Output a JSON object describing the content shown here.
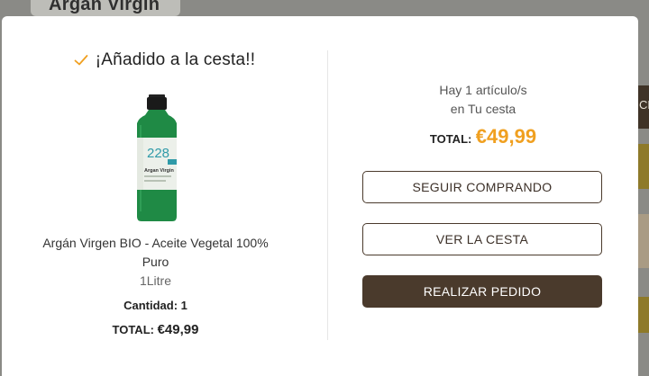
{
  "background": {
    "top_product_label": "Argán Virgin",
    "right_partial_text": "CE"
  },
  "modal": {
    "header": {
      "icon": "check-icon",
      "title": "¡Añadido a la cesta!!"
    },
    "product": {
      "image": "argan-oil-bottle",
      "image_label_number": "228",
      "image_label_name": "Argan Virgin",
      "name": "Argán Virgen BIO - Aceite Vegetal 100% Puro",
      "size": "1Litre",
      "quantity_label": "Cantidad:",
      "quantity_value": "1",
      "total_label": "TOTAL:",
      "total_value": "€49,99"
    },
    "cart": {
      "info_line1": "Hay 1 artículo/s",
      "info_line2": "en Tu cesta",
      "total_label": "TOTAL:",
      "total_value": "€49,99"
    },
    "buttons": {
      "continue": "SEGUIR COMPRANDO",
      "view_cart": "VER LA CESTA",
      "checkout": "REALIZAR PEDIDO"
    }
  },
  "colors": {
    "accent": "#f0a020",
    "brand_dark": "#4a3a2c",
    "overlay": "#8a8a86"
  }
}
